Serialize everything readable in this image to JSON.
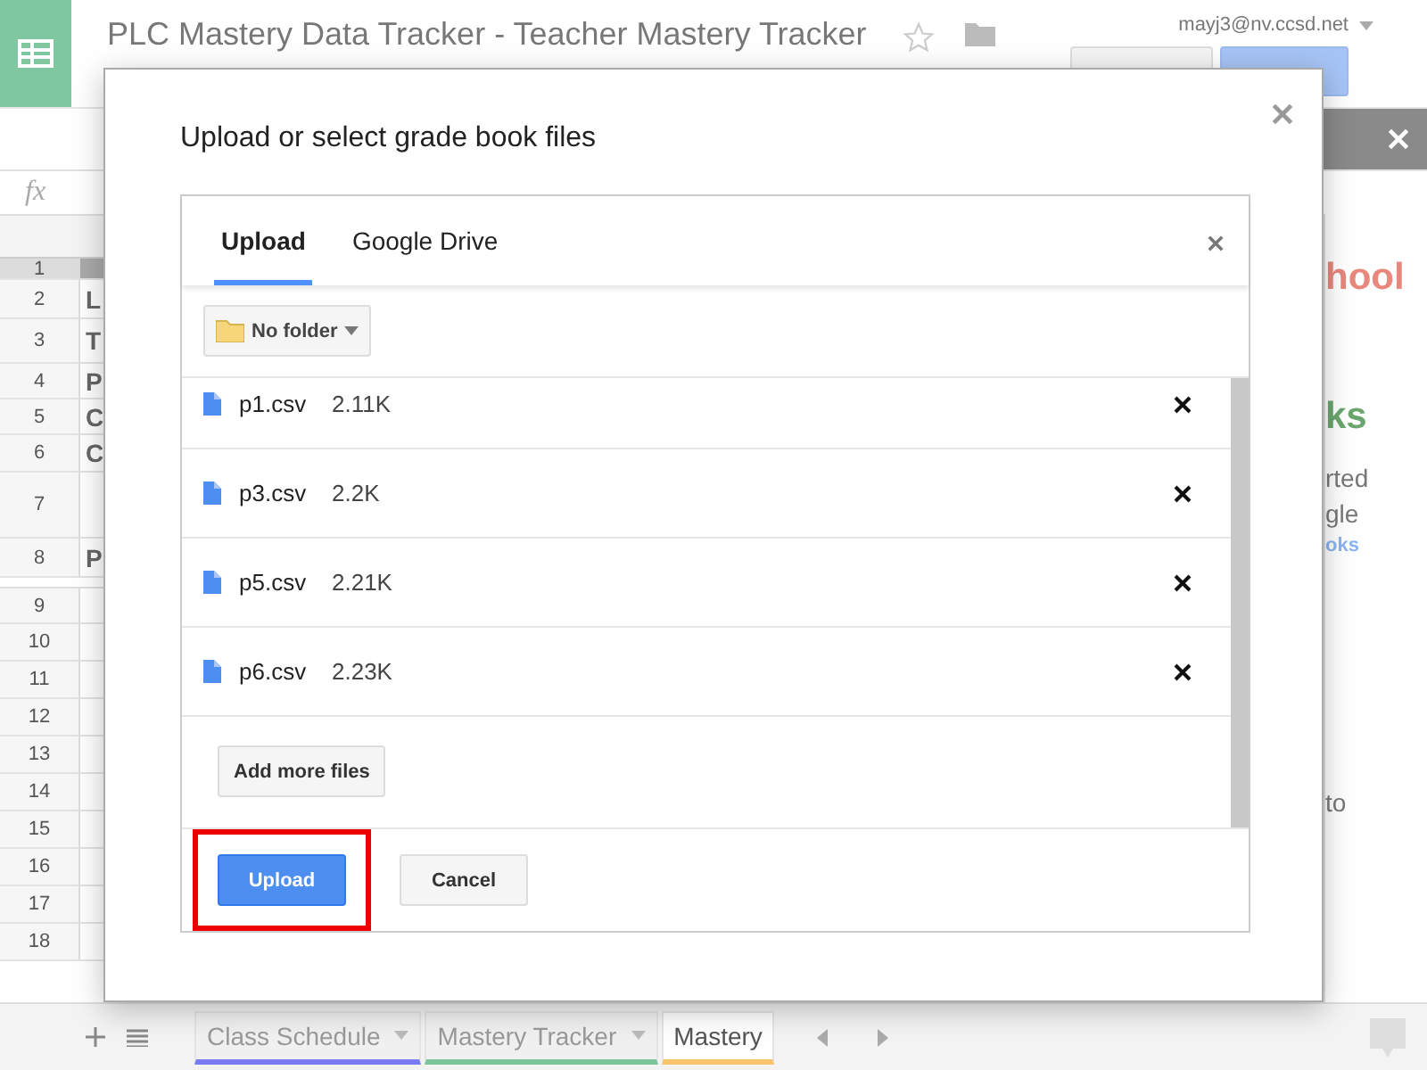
{
  "app": {
    "title": "PLC Mastery Data Tracker - Teacher Mastery Tracker",
    "account": "mayj3@nv.ccsd.net"
  },
  "formula_bar": {
    "label": "fx"
  },
  "grid_rows": [
    {
      "number": "1",
      "selected": true
    },
    {
      "number": "2",
      "cell": "L"
    },
    {
      "number": "3",
      "cell": "T"
    },
    {
      "number": "4",
      "cell": "P"
    },
    {
      "number": "5",
      "cell": "C"
    },
    {
      "number": "6",
      "cell": "C"
    },
    {
      "number": "7"
    },
    {
      "number": "8",
      "cell": "P"
    },
    {
      "number": "9"
    },
    {
      "number": "10"
    },
    {
      "number": "11"
    },
    {
      "number": "12"
    },
    {
      "number": "13"
    },
    {
      "number": "14"
    },
    {
      "number": "15"
    },
    {
      "number": "16"
    },
    {
      "number": "17"
    },
    {
      "number": "18"
    }
  ],
  "side_panel": [
    {
      "kind": "heading",
      "text": "hool",
      "color": "#e8877c"
    },
    {
      "kind": "heading",
      "text": "ks",
      "color": "#6aa66e"
    },
    {
      "kind": "body",
      "text": "rted"
    },
    {
      "kind": "body",
      "text": "gle"
    },
    {
      "kind": "link",
      "text": "oks"
    },
    {
      "kind": "body",
      "text": "to"
    }
  ],
  "sheet_tabs": [
    {
      "label": "Class Schedule",
      "color": "#7b7bf5",
      "selected": false
    },
    {
      "label": "Mastery Tracker",
      "color": "#7cc49a",
      "selected": false
    },
    {
      "label": "Mastery",
      "color": "#f9c46b",
      "selected": true
    }
  ],
  "dialog": {
    "title": "Upload or select grade book files",
    "tabs": [
      {
        "label": "Upload",
        "selected": true
      },
      {
        "label": "Google Drive",
        "selected": false
      }
    ],
    "folder": "No folder",
    "files": [
      {
        "name": "p1.csv",
        "size": "2.11K"
      },
      {
        "name": "p3.csv",
        "size": "2.2K"
      },
      {
        "name": "p5.csv",
        "size": "2.21K"
      },
      {
        "name": "p6.csv",
        "size": "2.23K"
      }
    ],
    "add_more": "Add more files",
    "buttons": [
      {
        "kind": "primary",
        "label": "Upload",
        "highlighted": true
      },
      {
        "kind": "secondary",
        "label": "Cancel",
        "highlighted": false
      }
    ]
  }
}
